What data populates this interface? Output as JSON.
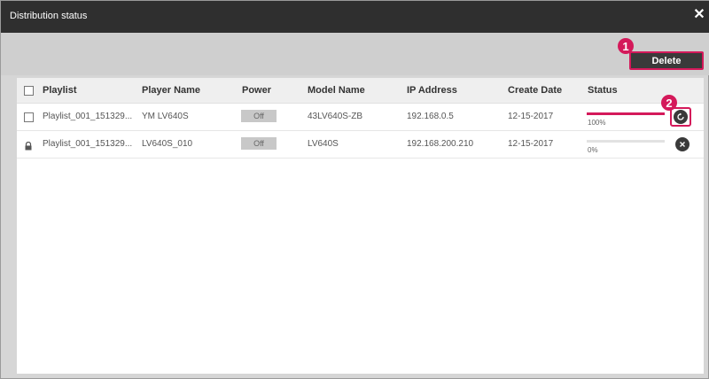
{
  "window": {
    "title": "Distribution status",
    "close_glyph": "✕"
  },
  "toolbar": {
    "delete_label": "Delete",
    "callout_1": "1",
    "callout_2": "2"
  },
  "table": {
    "headers": {
      "playlist": "Playlist",
      "player_name": "Player Name",
      "power": "Power",
      "model_name": "Model Name",
      "ip_address": "IP Address",
      "create_date": "Create Date",
      "status": "Status"
    },
    "rows": [
      {
        "playlist": "Playlist_001_151329...",
        "player_name": "YM LV640S",
        "power": "Off",
        "model_name": "43LV640S-ZB",
        "ip_address": "192.168.0.5",
        "create_date": "12-15-2017",
        "progress_pct": 100,
        "progress_label": "100%",
        "action_icon": "retry-icon",
        "checkbox": "unchecked"
      },
      {
        "playlist": "Playlist_001_151329...",
        "player_name": "LV640S_010",
        "power": "Off",
        "model_name": "LV640S",
        "ip_address": "192.168.200.210",
        "create_date": "12-15-2017",
        "progress_pct": 0,
        "progress_label": "0%",
        "action_icon": "cancel-icon",
        "checkbox": "locked"
      }
    ]
  },
  "colors": {
    "accent": "#d4195a",
    "titlebar": "#2f2f2f",
    "button": "#3a3a3a"
  }
}
